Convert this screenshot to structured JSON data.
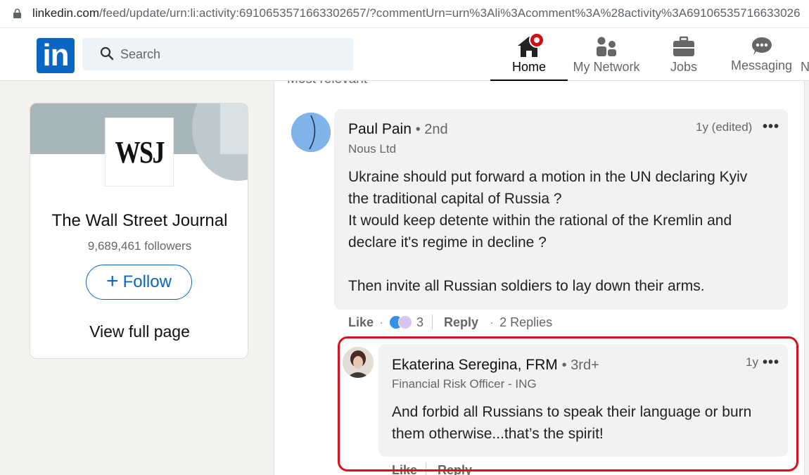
{
  "browser": {
    "url_host": "linkedin.com",
    "url_path": "/feed/update/urn:li:activity:6910653571663302657/?commentUrn=urn%3Ali%3Acomment%3A%28activity%3A69106535716633026"
  },
  "nav": {
    "logo_text": "in",
    "search_placeholder": "Search",
    "items": [
      {
        "label": "Home",
        "icon": "home-icon",
        "active": true
      },
      {
        "label": "My Network",
        "icon": "network-icon"
      },
      {
        "label": "Jobs",
        "icon": "briefcase-icon"
      },
      {
        "label": "Messaging",
        "icon": "messaging-icon"
      },
      {
        "label": "N"
      }
    ],
    "brand_color": "#0a66c2",
    "notification_color": "#cc1016"
  },
  "company_card": {
    "logo_text": "WSJ",
    "name": "The Wall Street Journal",
    "followers": "9,689,461 followers",
    "follow_label": "Follow",
    "view_full_label": "View full page"
  },
  "comments": {
    "sort_label": "Most relevant",
    "items": [
      {
        "author": "Paul Pain",
        "degree": "• 2nd",
        "headline": "Nous Ltd",
        "time": "1y (edited)",
        "more": "•••",
        "text": "Ukraine should put forward a motion in the UN declaring Kyiv\nthe traditional capital of Russia ?\nIt would keep detente within the rational of the Kremlin and\ndeclare it's regime in decline ?\n\nThen invite all Russian soldiers to lay down their arms.",
        "like_label": "Like",
        "reaction_count": "3",
        "reply_label": "Reply",
        "replies_label": "2 Replies"
      },
      {
        "author": "Ekaterina Seregina, FRM",
        "degree": "• 3rd+",
        "headline": "Financial Risk Officer - ING",
        "time": "1y",
        "more": "•••",
        "text": "And forbid all Russians to speak their language or burn\nthem otherwise...that’s the spirit!",
        "like_label": "Like",
        "reply_label": "Reply"
      }
    ]
  },
  "highlight_color": "#d3141f"
}
